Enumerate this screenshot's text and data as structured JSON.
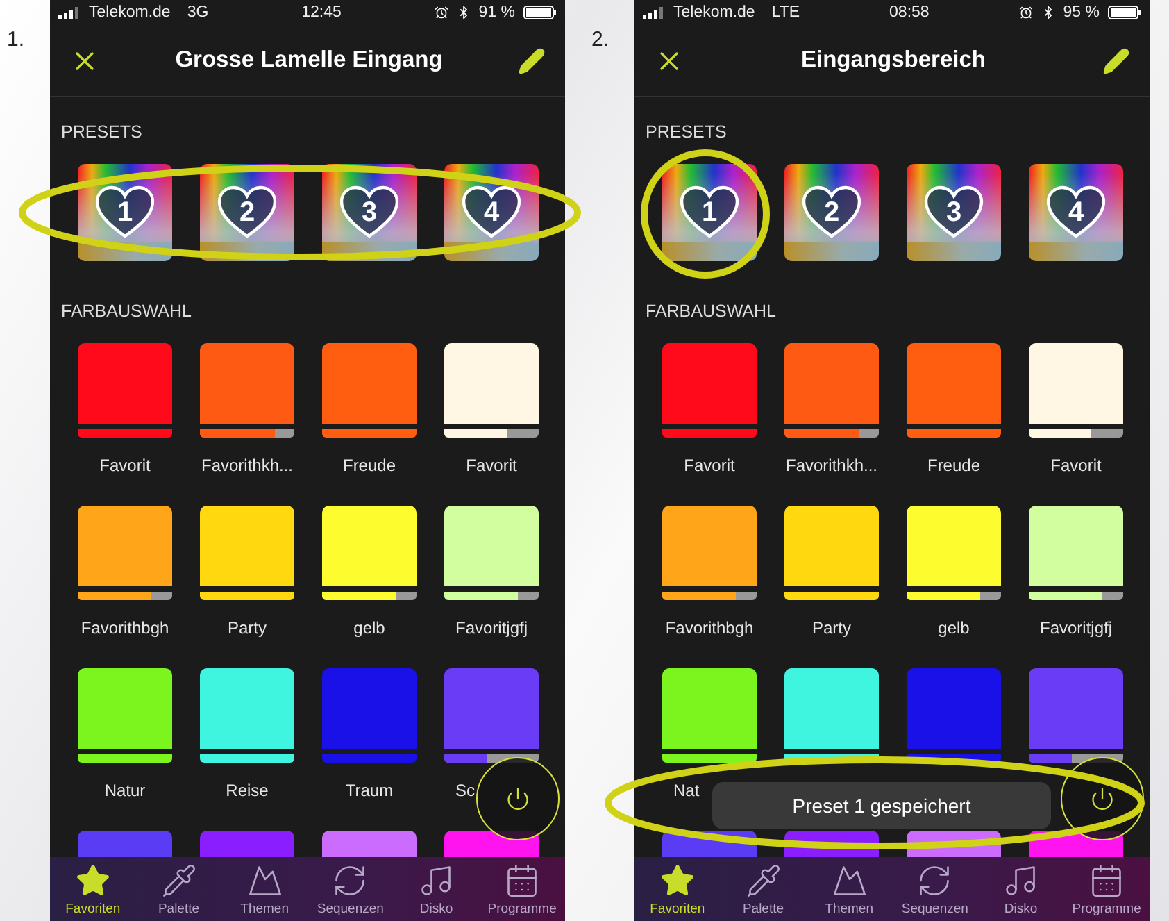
{
  "panels": [
    {
      "number": "1.",
      "status": {
        "carrier": "Telekom.de",
        "network": "3G",
        "time": "12:45",
        "battery": "91 %"
      },
      "title": "Grosse Lamelle Eingang",
      "presets_label": "PRESETS",
      "presets": [
        {
          "label": "1"
        },
        {
          "label": "2"
        },
        {
          "label": "3"
        },
        {
          "label": "4"
        }
      ],
      "colors_label": "FARBAUSWAHL",
      "colors": [
        {
          "name": "Favorit",
          "color": "#ff0a1a",
          "level": 1
        },
        {
          "name": "Favorithkh...",
          "color": "#ff5a14",
          "level": 0.8
        },
        {
          "name": "Freude",
          "color": "#ff5e10",
          "level": 1
        },
        {
          "name": "Favorit",
          "color": "#fff6e4",
          "level": 0.66
        },
        {
          "name": "Favorithbgh",
          "color": "#ffa51a",
          "level": 0.78
        },
        {
          "name": "Party",
          "color": "#ffd810",
          "level": 1
        },
        {
          "name": "gelb",
          "color": "#fdfc2e",
          "level": 0.78
        },
        {
          "name": "Favoritjgfj",
          "color": "#d2fea0",
          "level": 0.78
        },
        {
          "name": "Natur",
          "color": "#7cf51e",
          "level": 1
        },
        {
          "name": "Reise",
          "color": "#3ff5e0",
          "level": 1
        },
        {
          "name": "Traum",
          "color": "#1a10e8",
          "level": 1
        },
        {
          "name": "Sc",
          "color": "#6a3cf5",
          "level": 0.45,
          "clipped": true
        },
        {
          "color": "#5a3cf5"
        },
        {
          "color": "#8a1eff"
        },
        {
          "color": "#cc6cff"
        },
        {
          "color": "#ff14f0"
        }
      ],
      "highlights": [
        {
          "kind": "presets-row"
        }
      ],
      "tabs": [
        {
          "label": "Favoriten",
          "selected": true
        },
        {
          "label": "Palette",
          "selected": false
        },
        {
          "label": "Themen",
          "selected": false
        },
        {
          "label": "Sequenzen",
          "selected": false
        },
        {
          "label": "Disko",
          "selected": false
        },
        {
          "label": "Programme",
          "selected": false
        }
      ]
    },
    {
      "number": "2.",
      "status": {
        "carrier": "Telekom.de",
        "network": "LTE",
        "time": "08:58",
        "battery": "95 %"
      },
      "title": "Eingangsbereich",
      "presets_label": "PRESETS",
      "presets": [
        {
          "label": "1"
        },
        {
          "label": "2"
        },
        {
          "label": "3"
        },
        {
          "label": "4"
        }
      ],
      "colors_label": "FARBAUSWAHL",
      "colors": [
        {
          "name": "Favorit",
          "color": "#ff0a1a",
          "level": 1
        },
        {
          "name": "Favorithkh...",
          "color": "#ff5a14",
          "level": 0.8
        },
        {
          "name": "Freude",
          "color": "#ff5e10",
          "level": 1
        },
        {
          "name": "Favorit",
          "color": "#fff6e4",
          "level": 0.66
        },
        {
          "name": "Favorithbgh",
          "color": "#ffa51a",
          "level": 0.78
        },
        {
          "name": "Party",
          "color": "#ffd810",
          "level": 1
        },
        {
          "name": "gelb",
          "color": "#fdfc2e",
          "level": 0.78
        },
        {
          "name": "Favoritjgfj",
          "color": "#d2fea0",
          "level": 0.78
        },
        {
          "name": "Nat",
          "color": "#7cf51e",
          "level": 1,
          "clipped": true
        },
        {
          "color": "#3ff5e0",
          "level": 1
        },
        {
          "color": "#1a10e8",
          "level": 1
        },
        {
          "color": "#6a3cf5",
          "level": 0.45
        },
        {
          "color": "#5a3cf5"
        },
        {
          "color": "#8a1eff"
        },
        {
          "color": "#cc6cff"
        },
        {
          "color": "#ff14f0"
        }
      ],
      "toast": "Preset 1 gespeichert",
      "highlights": [
        {
          "kind": "first-preset"
        },
        {
          "kind": "toast"
        }
      ],
      "tabs": [
        {
          "label": "Favoriten",
          "selected": true
        },
        {
          "label": "Palette",
          "selected": false
        },
        {
          "label": "Themen",
          "selected": false
        },
        {
          "label": "Sequenzen",
          "selected": false
        },
        {
          "label": "Disko",
          "selected": false
        },
        {
          "label": "Programme",
          "selected": false
        }
      ]
    }
  ]
}
